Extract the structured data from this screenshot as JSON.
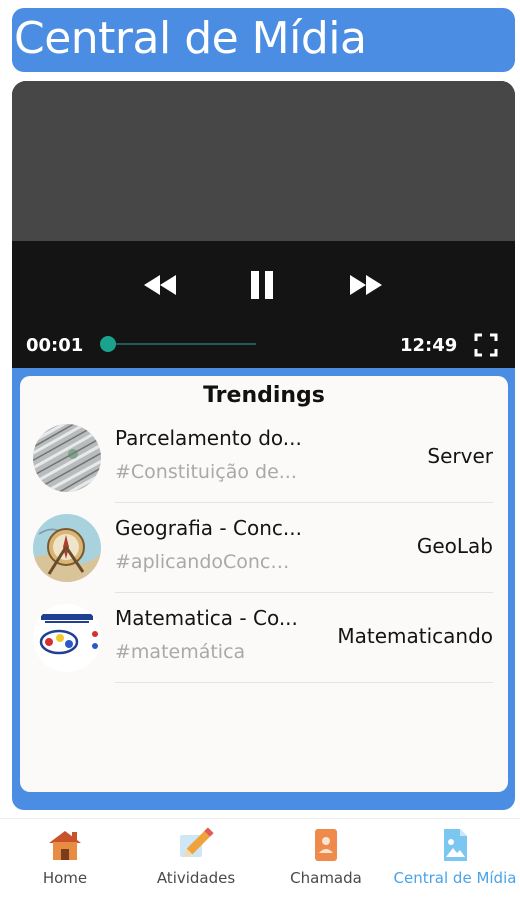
{
  "header": {
    "title": "Central de Mídia"
  },
  "player": {
    "current_time": "00:01",
    "duration": "12:49",
    "progress": 0.01
  },
  "trending": {
    "title": "Trendings",
    "items": [
      {
        "title": "Parcelamento do...",
        "tag": "#Constituição de...",
        "channel": "Server",
        "thumb": "money-stack-thumbnail"
      },
      {
        "title": "Geografia - Conc...",
        "tag": "#aplicandoConcei...",
        "channel": "GeoLab",
        "thumb": "compass-map-thumbnail"
      },
      {
        "title": "Matematica - Co...",
        "tag": "#matemática",
        "channel": "Matematicando",
        "thumb": "math-logo-thumbnail"
      }
    ]
  },
  "nav": {
    "items": [
      {
        "label": "Home",
        "icon": "house-icon"
      },
      {
        "label": "Atividades",
        "icon": "pencil-icon"
      },
      {
        "label": "Chamada",
        "icon": "contact-card-icon"
      },
      {
        "label": "Central de Mídia",
        "icon": "image-file-icon",
        "active": true
      }
    ]
  },
  "colors": {
    "accent": "#4a8de2",
    "seek": "#1aa38f",
    "active_nav": "#4aa3e8"
  }
}
